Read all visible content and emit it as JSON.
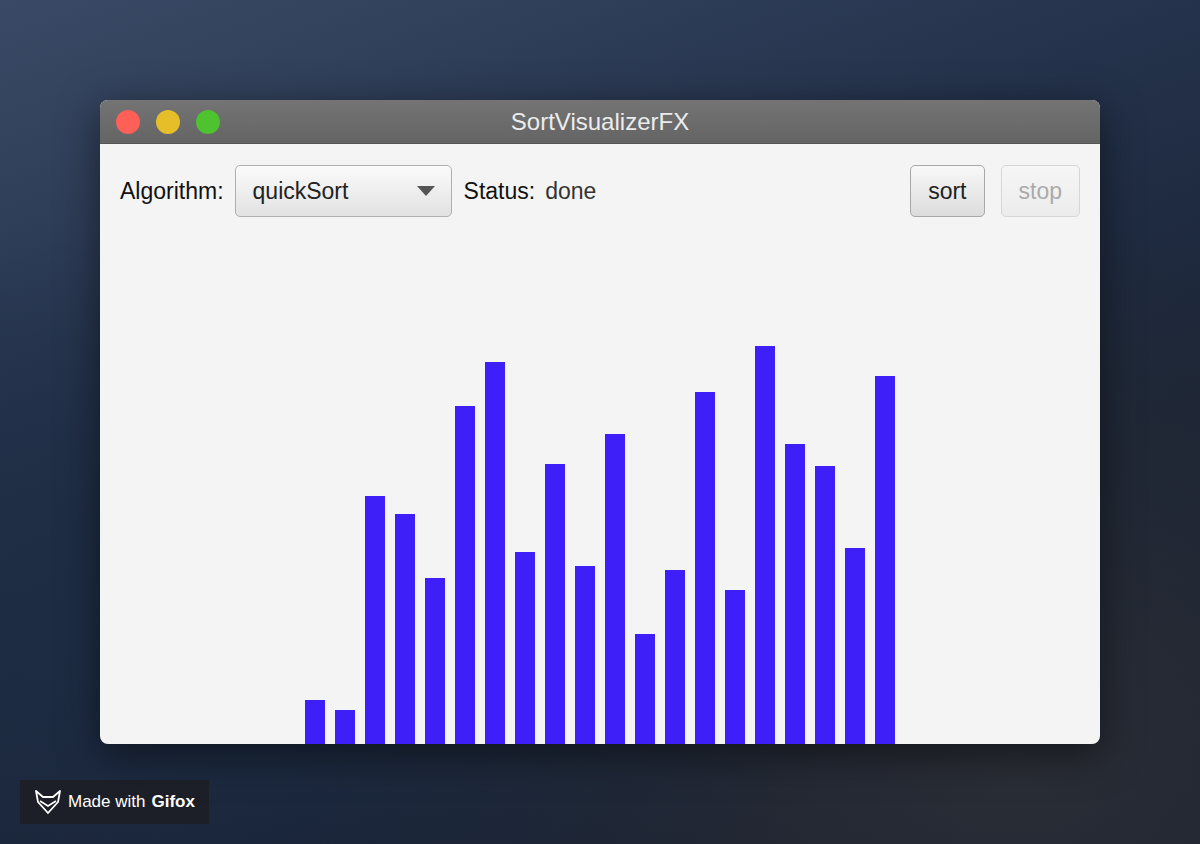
{
  "window": {
    "title": "SortVisualizerFX",
    "window_buttons": [
      {
        "name": "close",
        "color": "#fe5f57"
      },
      {
        "name": "minimize",
        "color": "#e6be2a"
      },
      {
        "name": "zoom",
        "color": "#4fc22f"
      }
    ]
  },
  "toolbar": {
    "algorithm_label": "Algorithm:",
    "algorithm_value": "quickSort",
    "status_label": "Status:",
    "status": "done",
    "buttons": [
      {
        "label": "sort",
        "disabled": false
      },
      {
        "label": "stop",
        "disabled": true
      }
    ]
  },
  "chart": {
    "values": [
      44,
      34,
      248,
      230,
      166,
      338,
      382,
      192,
      280,
      178,
      310,
      110,
      174,
      352,
      154,
      398,
      300,
      278,
      196,
      368
    ]
  },
  "watermark": {
    "prefix": "Made with",
    "brand": "Gifox"
  }
}
